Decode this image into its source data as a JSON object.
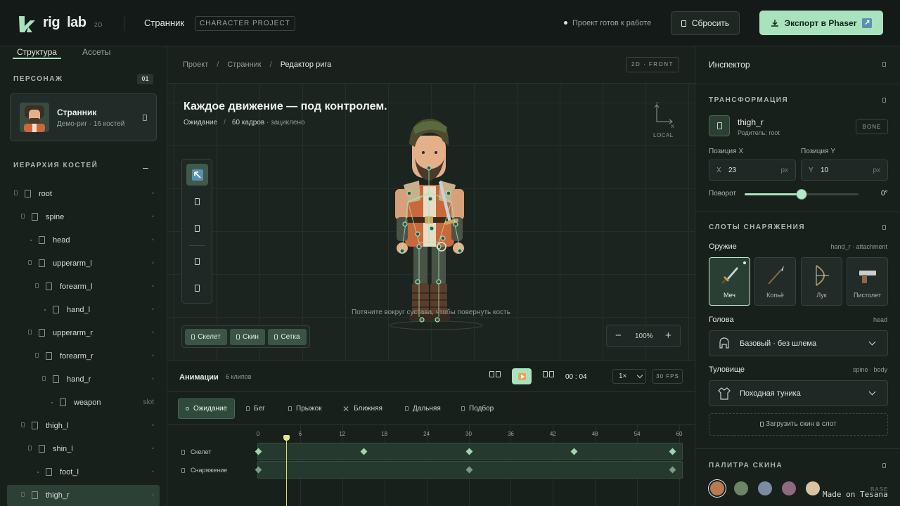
{
  "header": {
    "brand_1": "rig",
    "brand_2": "lab",
    "brand_badge": "2D",
    "project_name": "Странник",
    "project_tag": "CHARACTER PROJECT",
    "status": "Проект готов к работе",
    "reset_label": "Сбросить",
    "export_label": "Экспорт в Phaser",
    "accent_color": "#a9e3bd"
  },
  "left": {
    "tabs": [
      "Структура",
      "Ассеты"
    ],
    "character_section": "ПЕРСОНАЖ",
    "character_count": "01",
    "character": {
      "name": "Странник",
      "subtitle": "Демо-риг · 16 костей"
    },
    "hierarchy_section": "ИЕРАРХИЯ КОСТЕЙ",
    "collapse": "–",
    "bones": [
      {
        "label": "root",
        "end": "◦"
      },
      {
        "label": "spine",
        "end": "◦"
      },
      {
        "label": "head",
        "end": "◦"
      },
      {
        "label": "upperarm_l",
        "end": "◦"
      },
      {
        "label": "forearm_l",
        "end": "◦"
      },
      {
        "label": "hand_l",
        "end": "◦"
      },
      {
        "label": "upperarm_r",
        "end": "◦"
      },
      {
        "label": "forearm_r",
        "end": "◦"
      },
      {
        "label": "hand_r",
        "end": "◦"
      },
      {
        "label": "weapon",
        "end": "slot"
      },
      {
        "label": "thigh_l",
        "end": "◦"
      },
      {
        "label": "shin_l",
        "end": "◦"
      },
      {
        "label": "foot_l",
        "end": "◦"
      },
      {
        "label": "thigh_r",
        "end": "◦"
      }
    ]
  },
  "center": {
    "breadcrumb": [
      "Проект",
      "Странник",
      "Редактор рига"
    ],
    "view_badge": "2D · FRONT",
    "title": "Каждое движение — под контролем.",
    "sub_anim": "Ожидание",
    "sub_frames": "60 кадров",
    "sub_loop": "· зациклено",
    "axis_x": "X",
    "axis_y": "Y",
    "axis_local": "LOCAL",
    "hint": "Потяните вокруг сустава, чтобы повернуть кость",
    "layers": [
      "Скелет",
      "Скин",
      "Сетка"
    ],
    "zoom_minus": "−",
    "zoom_plus": "+",
    "zoom_value": "100%"
  },
  "timeline": {
    "title": "Анимации",
    "count": "6 клипов",
    "timecode": "00 : 04",
    "speed": "1×",
    "fps": "30 FPS",
    "clips": [
      "Ожидание",
      "Бег",
      "Прыжок",
      "Ближняя",
      "Дальняя",
      "Подбор"
    ],
    "ticks": [
      "0",
      "6",
      "12",
      "18",
      "24",
      "30",
      "36",
      "42",
      "48",
      "54",
      "60"
    ],
    "tracks": [
      "Скелет",
      "Снаряжение"
    ],
    "playhead_frame": 4,
    "keyframes_skeleton": [
      0,
      15,
      30,
      45,
      59
    ],
    "keyframes_gear": [
      0,
      30,
      59
    ]
  },
  "inspector": {
    "title": "Инспектор",
    "transform_section": "ТРАНСФОРМАЦИЯ",
    "bone_name": "thigh_r",
    "bone_parent": "Родитель: root",
    "bone_tag": "BONE",
    "pos_x_label": "Позиция X",
    "pos_y_label": "Позиция Y",
    "pos_x": {
      "k": "X",
      "v": "23",
      "u": "px"
    },
    "pos_y": {
      "k": "Y",
      "v": "10",
      "u": "px"
    },
    "rotation_label": "Поворот",
    "rotation_value": "0°",
    "rotation_fraction": 0.5,
    "slots_section": "СЛОТЫ СНАРЯЖЕНИЯ",
    "weapon_label": "Оружие",
    "weapon_meta": "hand_r · attachment",
    "weapons": [
      "Меч",
      "Копьё",
      "Лук",
      "Пистолет"
    ],
    "head_label": "Голова",
    "head_meta": "head",
    "head_value": "Базовый · без шлема",
    "torso_label": "Туловище",
    "torso_meta": "spine · body",
    "torso_value": "Походная туника",
    "upload_label": "Загрузить скин в слот",
    "palette_section": "ПАЛИТРА СКИНА",
    "palette": [
      "#b87a52",
      "#6e8466",
      "#7d8aa3",
      "#8e6a7e",
      "#d9c3a2"
    ],
    "palette_base": "BASE"
  },
  "watermark": "Made on Tesana"
}
